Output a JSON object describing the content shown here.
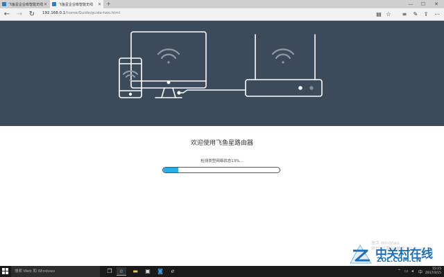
{
  "browser": {
    "tabs": [
      {
        "title": "飞鱼星企业级智能无线 | 网",
        "active": false
      },
      {
        "title": "飞鱼星企业级智能无线",
        "active": true
      }
    ],
    "new_tab_glyph": "+",
    "url_host": "192.168.0.1",
    "url_path": "/home/Guide/guide-two.html",
    "window_controls": [
      "—",
      "☐",
      "✕"
    ],
    "nav_icons": [
      "back-icon",
      "forward-icon",
      "refresh-icon"
    ],
    "toolbar_icons": [
      "reading-view-icon",
      "favorite-star-icon",
      "hub-icon",
      "web-note-icon",
      "share-icon",
      "more-icon"
    ]
  },
  "page": {
    "title": "欢迎使用飞鱼星路由器",
    "status_text": "检测类型网络状态13%...",
    "progress_percent": 13,
    "accent_color": "#29aee6",
    "hero_color": "#3b4b5b"
  },
  "taskbar": {
    "search_placeholder": "搜索 Web 和 Windows",
    "clock_time": "15:15",
    "clock_date": "2017/3/15"
  },
  "watermark": {
    "activate_line1": "激活 Windows",
    "activate_line2": "转到“设置”以激活 Windows。",
    "brand": "中关村在线",
    "site": "ZOL.COM.CN"
  }
}
